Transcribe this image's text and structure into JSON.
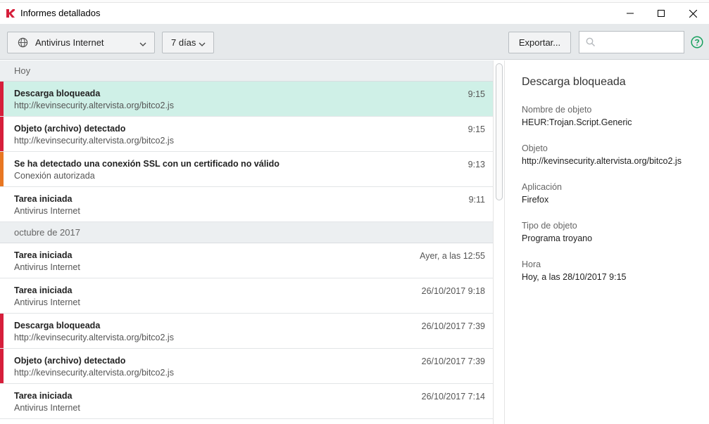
{
  "window": {
    "title": "Informes detallados"
  },
  "toolbar": {
    "component_dropdown": "Antivirus Internet",
    "period_dropdown": "7 días",
    "export_label": "Exportar...",
    "search_placeholder": ""
  },
  "colors": {
    "severity_red": "#d61f3b",
    "severity_orange": "#e87722",
    "selected_row": "#cff0e7",
    "help_green": "#16a05d"
  },
  "icons": {
    "app": "kaspersky-logo-icon",
    "component": "globe-icon",
    "chevron": "chevron-down-icon",
    "search": "search-icon",
    "help": "help-icon"
  },
  "groups": [
    {
      "label": "Hoy",
      "events": [
        {
          "title": "Descarga bloqueada",
          "subtitle": "http://kevinsecurity.altervista.org/bitco2.js",
          "time": "9:15",
          "severity": "red",
          "selected": true
        },
        {
          "title": "Objeto (archivo) detectado",
          "subtitle": "http://kevinsecurity.altervista.org/bitco2.js",
          "time": "9:15",
          "severity": "red",
          "selected": false
        },
        {
          "title": "Se ha detectado una conexión SSL con un certificado no válido",
          "subtitle": "Conexión autorizada",
          "time": "9:13",
          "severity": "orange",
          "selected": false
        },
        {
          "title": "Tarea iniciada",
          "subtitle": "Antivirus Internet",
          "time": "9:11",
          "severity": "none",
          "selected": false
        }
      ]
    },
    {
      "label": "octubre de 2017",
      "events": [
        {
          "title": "Tarea iniciada",
          "subtitle": "Antivirus Internet",
          "time": "Ayer, a las 12:55",
          "severity": "none",
          "selected": false
        },
        {
          "title": "Tarea iniciada",
          "subtitle": "Antivirus Internet",
          "time": "26/10/2017 9:18",
          "severity": "none",
          "selected": false
        },
        {
          "title": "Descarga bloqueada",
          "subtitle": "http://kevinsecurity.altervista.org/bitco2.js",
          "time": "26/10/2017 7:39",
          "severity": "red",
          "selected": false
        },
        {
          "title": "Objeto (archivo) detectado",
          "subtitle": "http://kevinsecurity.altervista.org/bitco2.js",
          "time": "26/10/2017 7:39",
          "severity": "red",
          "selected": false
        },
        {
          "title": "Tarea iniciada",
          "subtitle": "Antivirus Internet",
          "time": "26/10/2017 7:14",
          "severity": "none",
          "selected": false
        }
      ]
    }
  ],
  "detail": {
    "heading": "Descarga bloqueada",
    "fields": [
      {
        "label": "Nombre de objeto",
        "value": "HEUR:Trojan.Script.Generic"
      },
      {
        "label": "Objeto",
        "value": "http://kevinsecurity.altervista.org/bitco2.js"
      },
      {
        "label": "Aplicación",
        "value": "Firefox"
      },
      {
        "label": "Tipo de objeto",
        "value": "Programa troyano"
      },
      {
        "label": "Hora",
        "value": "Hoy, a las 28/10/2017 9:15"
      }
    ]
  }
}
